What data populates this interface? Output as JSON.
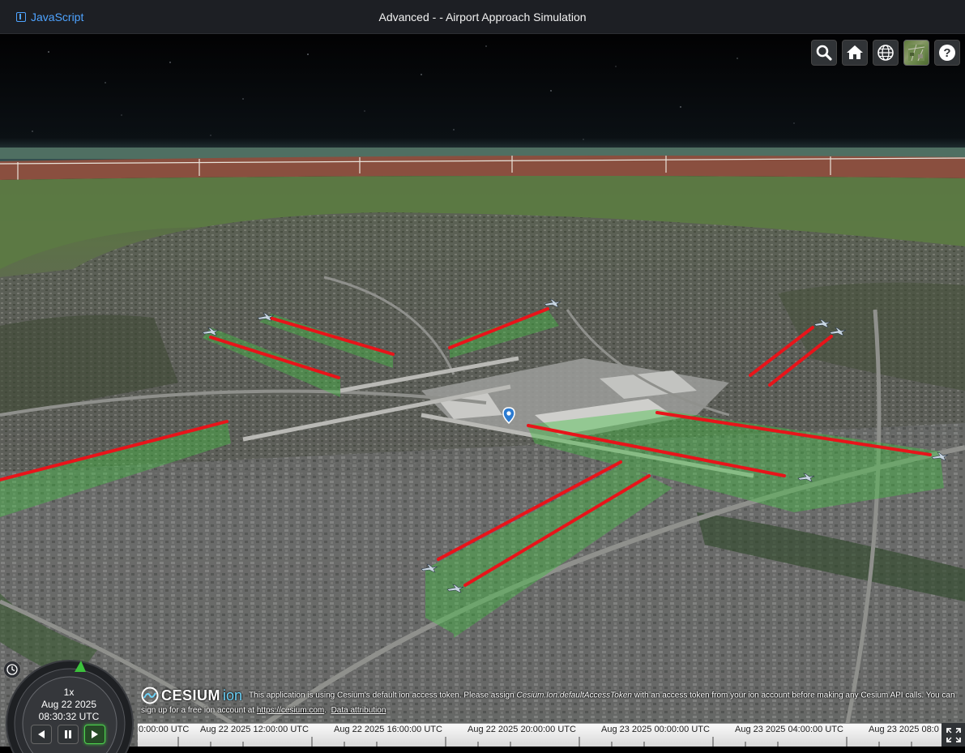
{
  "header": {
    "lang_link": "JavaScript",
    "title": "Advanced - - Airport Approach Simulation"
  },
  "toolbar": {
    "buttons": [
      "search-icon",
      "home-icon",
      "globe-icon",
      "base-layer-picker",
      "help-icon"
    ],
    "help_label": "?"
  },
  "animation": {
    "speed": "1x",
    "date": "Aug 22 2025",
    "time": "08:30:32 UTC"
  },
  "credits": {
    "logo_word": "CESIUM",
    "logo_suffix": "ion",
    "text_before": "This application is using Cesium's default ion access token. Please assign ",
    "text_code": "Cesium.Ion.defaultAccessToken",
    "text_after": " with an access token from your ion account before making any Cesium API calls. You can sign up for a free ion account at ",
    "signup_link": "https://cesium.com",
    "period": ".",
    "attribution_link": "Data attribution"
  },
  "timeline": {
    "labels": [
      "0:00:00 UTC",
      "Aug 22 2025 12:00:00 UTC",
      "Aug 22 2025 16:00:00 UTC",
      "Aug 22 2025 20:00:00 UTC",
      "Aug 23 2025 00:00:00 UTC",
      "Aug 23 2025 04:00:00 UTC",
      "Aug 23 2025 08:0"
    ]
  },
  "colors": {
    "approach_line": "#e8141a",
    "approach_zone": "#43c043",
    "sky": "#000000",
    "topbar": "#1d1f24",
    "link": "#4ea3ff"
  }
}
